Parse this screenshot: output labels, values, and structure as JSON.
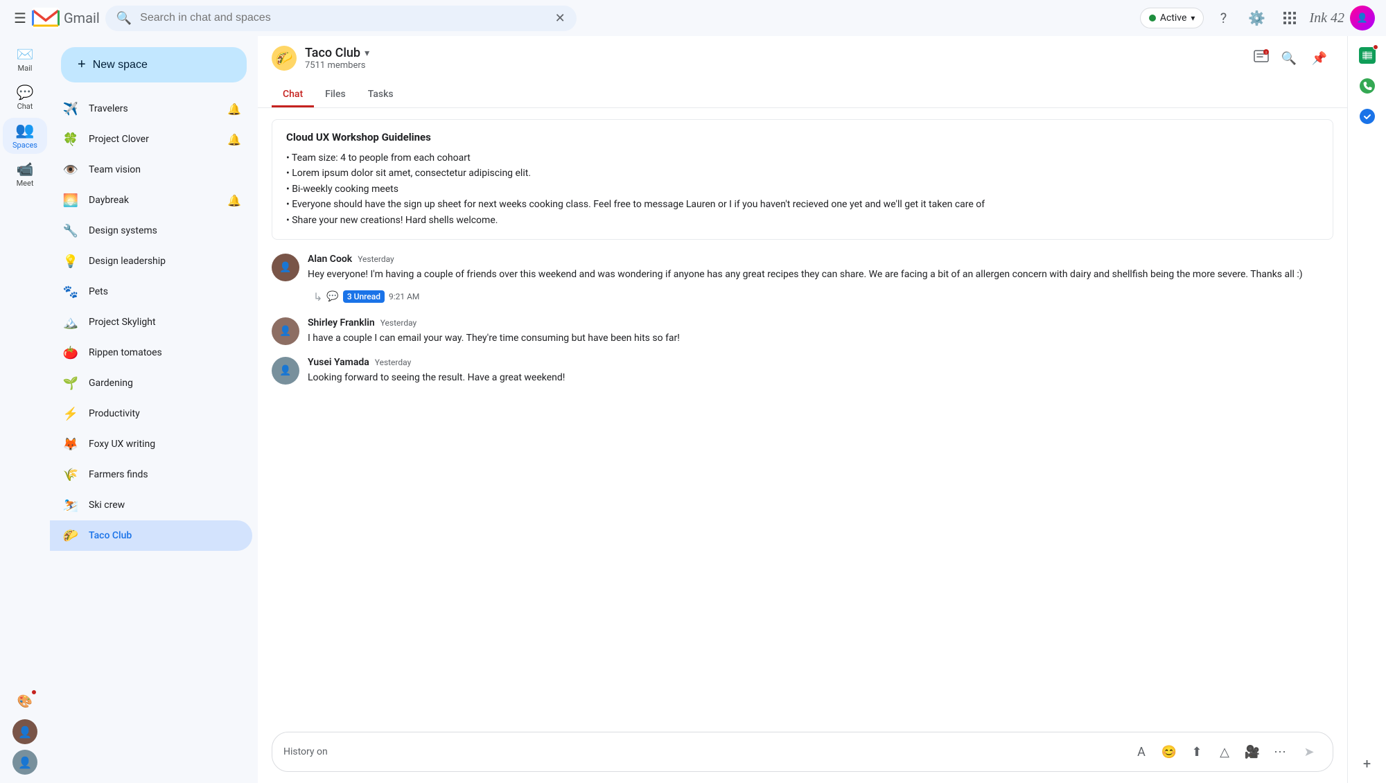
{
  "topbar": {
    "search_placeholder": "Search in chat and spaces",
    "status_label": "Active",
    "status_color": "#1e8e3e"
  },
  "sidebar": {
    "new_space_label": "New space",
    "items": [
      {
        "emoji": "✈️",
        "name": "Travelers",
        "bell": true,
        "selected": false
      },
      {
        "emoji": "🍀",
        "name": "Project Clover",
        "bell": true,
        "selected": false
      },
      {
        "emoji": "👁️",
        "name": "Team vision",
        "bell": false,
        "selected": false
      },
      {
        "emoji": "🌅",
        "name": "Daybreak",
        "bell": true,
        "selected": false
      },
      {
        "emoji": "🔧",
        "name": "Design systems",
        "bell": false,
        "selected": false
      },
      {
        "emoji": "💡",
        "name": "Design leadership",
        "bell": false,
        "selected": false
      },
      {
        "emoji": "🐾",
        "name": "Pets",
        "bell": false,
        "selected": false
      },
      {
        "emoji": "🏔️",
        "name": "Project Skylight",
        "bell": false,
        "selected": false
      },
      {
        "emoji": "🍅",
        "name": "Rippen tomatoes",
        "bell": false,
        "selected": false
      },
      {
        "emoji": "🌱",
        "name": "Gardening",
        "bell": false,
        "selected": false
      },
      {
        "emoji": "⚡",
        "name": "Productivity",
        "bell": false,
        "selected": false
      },
      {
        "emoji": "🦊",
        "name": "Foxy UX writing",
        "bell": false,
        "selected": false
      },
      {
        "emoji": "🌾",
        "name": "Farmers finds",
        "bell": false,
        "selected": false
      },
      {
        "emoji": "⛷️",
        "name": "Ski crew",
        "bell": false,
        "selected": false
      },
      {
        "emoji": "🌮",
        "name": "Taco Club",
        "bell": false,
        "selected": true
      }
    ]
  },
  "chat": {
    "space_name": "Taco Club",
    "space_members": "7511 members",
    "tabs": [
      {
        "label": "Chat",
        "active": true
      },
      {
        "label": "Files",
        "active": false
      },
      {
        "label": "Tasks",
        "active": false
      }
    ],
    "pinned": {
      "title": "Cloud UX Workshop Guidelines",
      "bullets": [
        "Team size: 4 to people from each cohoart",
        "Lorem ipsum dolor sit amet, consectetur adipiscing elit.",
        "Bi-weekly cooking meets",
        "Everyone should have the sign up sheet for next weeks cooking class. Feel free to message Lauren or I if you haven't recieved one yet and we'll get it taken care of",
        "Share your new creations! Hard shells welcome."
      ]
    },
    "messages": [
      {
        "author": "Alan Cook",
        "time": "Yesterday",
        "avatar_color": "#795548",
        "text": "Hey everyone! I'm having a couple of friends over this weekend and was wondering if anyone has any great recipes they can share. We are facing a bit of an allergen concern with dairy and shellfish being the more severe. Thanks all :)",
        "thread": {
          "label": "3 Unread",
          "time": "9:21 AM"
        }
      },
      {
        "author": "Shirley Franklin",
        "time": "Yesterday",
        "avatar_color": "#8d6e63",
        "text": "I have a couple I can email your way. They're time consuming but have been hits so far!",
        "thread": null
      },
      {
        "author": "Yusei Yamada",
        "time": "Yesterday",
        "avatar_color": "#78909c",
        "text": "Looking forward to seeing the result. Have a great weekend!",
        "thread": null
      }
    ],
    "input_placeholder": "History on"
  },
  "rail": {
    "items": [
      {
        "icon": "✉️",
        "label": "Mail"
      },
      {
        "icon": "💬",
        "label": "Chat"
      },
      {
        "icon": "👥",
        "label": "Spaces",
        "active": true
      },
      {
        "icon": "📹",
        "label": "Meet"
      }
    ]
  },
  "right_apps": [
    {
      "icon": "📋",
      "has_notification": true,
      "color": "#1a73e8"
    },
    {
      "icon": "📞",
      "has_notification": false,
      "color": "#34a853"
    },
    {
      "icon": "✅",
      "has_notification": false,
      "color": "#1a73e8"
    }
  ]
}
